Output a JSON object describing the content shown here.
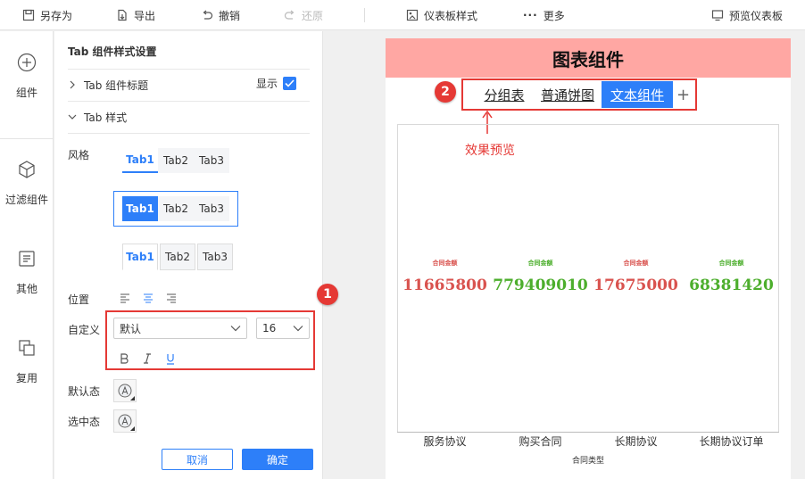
{
  "toolbar": {
    "save_as": "另存为",
    "export": "导出",
    "undo": "撤销",
    "redo": "还原",
    "dashboard_style": "仪表板样式",
    "more": "更多",
    "preview": "预览仪表板"
  },
  "rail": {
    "items": [
      {
        "label": "组件",
        "icon": "plus-circle-icon"
      },
      {
        "label": "过滤组件",
        "icon": "cube-icon"
      },
      {
        "label": "其他",
        "icon": "text-doc-icon"
      },
      {
        "label": "复用",
        "icon": "layers-icon"
      }
    ]
  },
  "panel": {
    "title": "Tab 组件样式设置",
    "section_tab_title": "Tab 组件标题",
    "show_label": "显示",
    "show_checked": true,
    "section_tab_style": "Tab 样式",
    "style_label": "风格",
    "style_tabs": [
      "Tab1",
      "Tab2",
      "Tab3"
    ],
    "position_label": "位置",
    "custom_label": "自定义",
    "font_value": "默认",
    "size_value": "16",
    "default_state_label": "默认态",
    "selected_state_label": "选中态",
    "cancel": "取消",
    "ok": "确定"
  },
  "badges": {
    "one": "1",
    "two": "2"
  },
  "canvas": {
    "title": "图表组件",
    "tabs": [
      "分组表",
      "普通饼图",
      "文本组件"
    ],
    "active_tab": 2,
    "add_tab": "+",
    "effect_label": "效果预览",
    "accent_color": "#2d7ff9",
    "title_bg": "#ffa7a3"
  },
  "chart_data": {
    "type": "table",
    "categories": [
      "服务协议",
      "购买合同",
      "长期协议",
      "长期协议订单"
    ],
    "value_label": "合同金额",
    "values": [
      11665800,
      779409010,
      17675000,
      68381420
    ],
    "value_texts": [
      "11665800",
      "779409010",
      "17675000",
      "68381420"
    ],
    "colors": [
      "#d9534f",
      "#4cae2c",
      "#d9534f",
      "#4cae2c"
    ],
    "xlabel": "合同类型"
  }
}
